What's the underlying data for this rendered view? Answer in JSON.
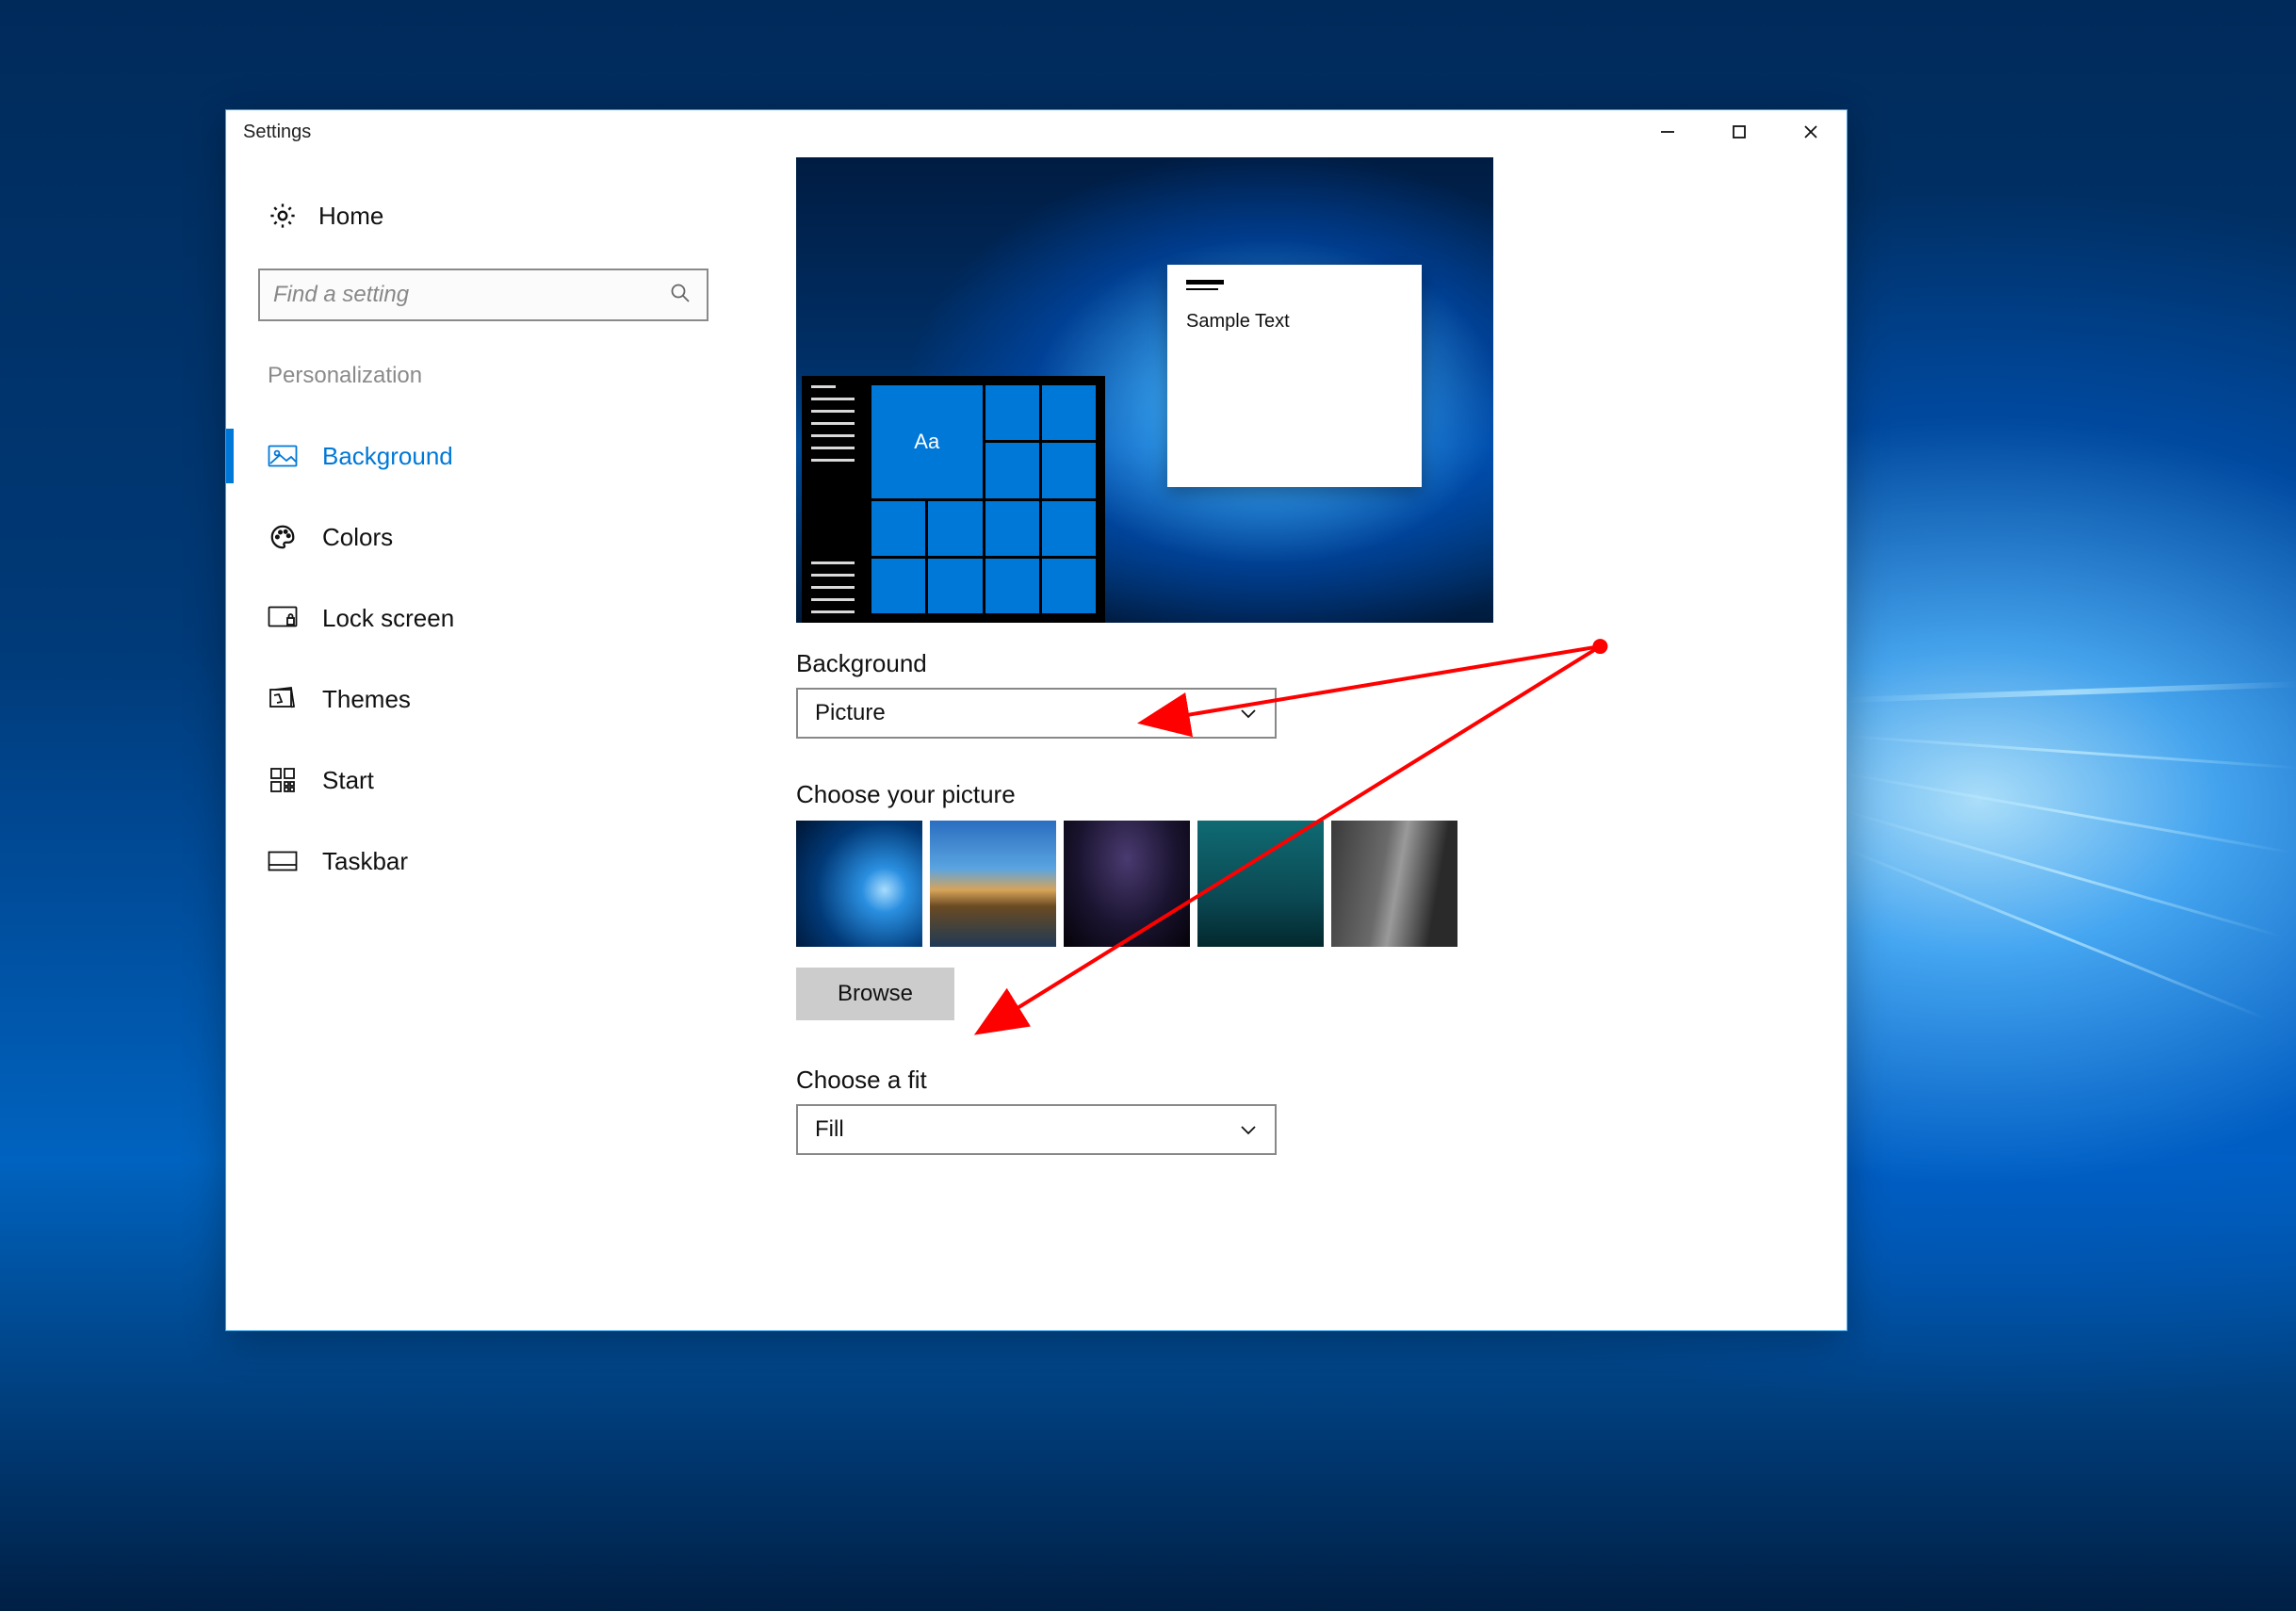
{
  "window": {
    "title": "Settings",
    "controls": {
      "minimize_label": "Minimize",
      "maximize_label": "Restore",
      "close_label": "Close"
    }
  },
  "sidebar": {
    "home_label": "Home",
    "search_placeholder": "Find a setting",
    "category": "Personalization",
    "items": [
      {
        "id": "background",
        "label": "Background",
        "active": true
      },
      {
        "id": "colors",
        "label": "Colors",
        "active": false
      },
      {
        "id": "lock-screen",
        "label": "Lock screen",
        "active": false
      },
      {
        "id": "themes",
        "label": "Themes",
        "active": false
      },
      {
        "id": "start",
        "label": "Start",
        "active": false
      },
      {
        "id": "taskbar",
        "label": "Taskbar",
        "active": false
      }
    ]
  },
  "main": {
    "preview": {
      "tile_text": "Aa",
      "sample_window_text": "Sample Text"
    },
    "background_section": {
      "label": "Background",
      "value": "Picture"
    },
    "choose_picture": {
      "label": "Choose your picture",
      "thumbs": [
        "win10-hero",
        "beach-rocks",
        "night-camp",
        "underwater",
        "rock-wall"
      ],
      "browse_label": "Browse"
    },
    "choose_fit": {
      "label": "Choose a fit",
      "value": "Fill"
    }
  },
  "annotation": {
    "color": "#ff0000"
  }
}
